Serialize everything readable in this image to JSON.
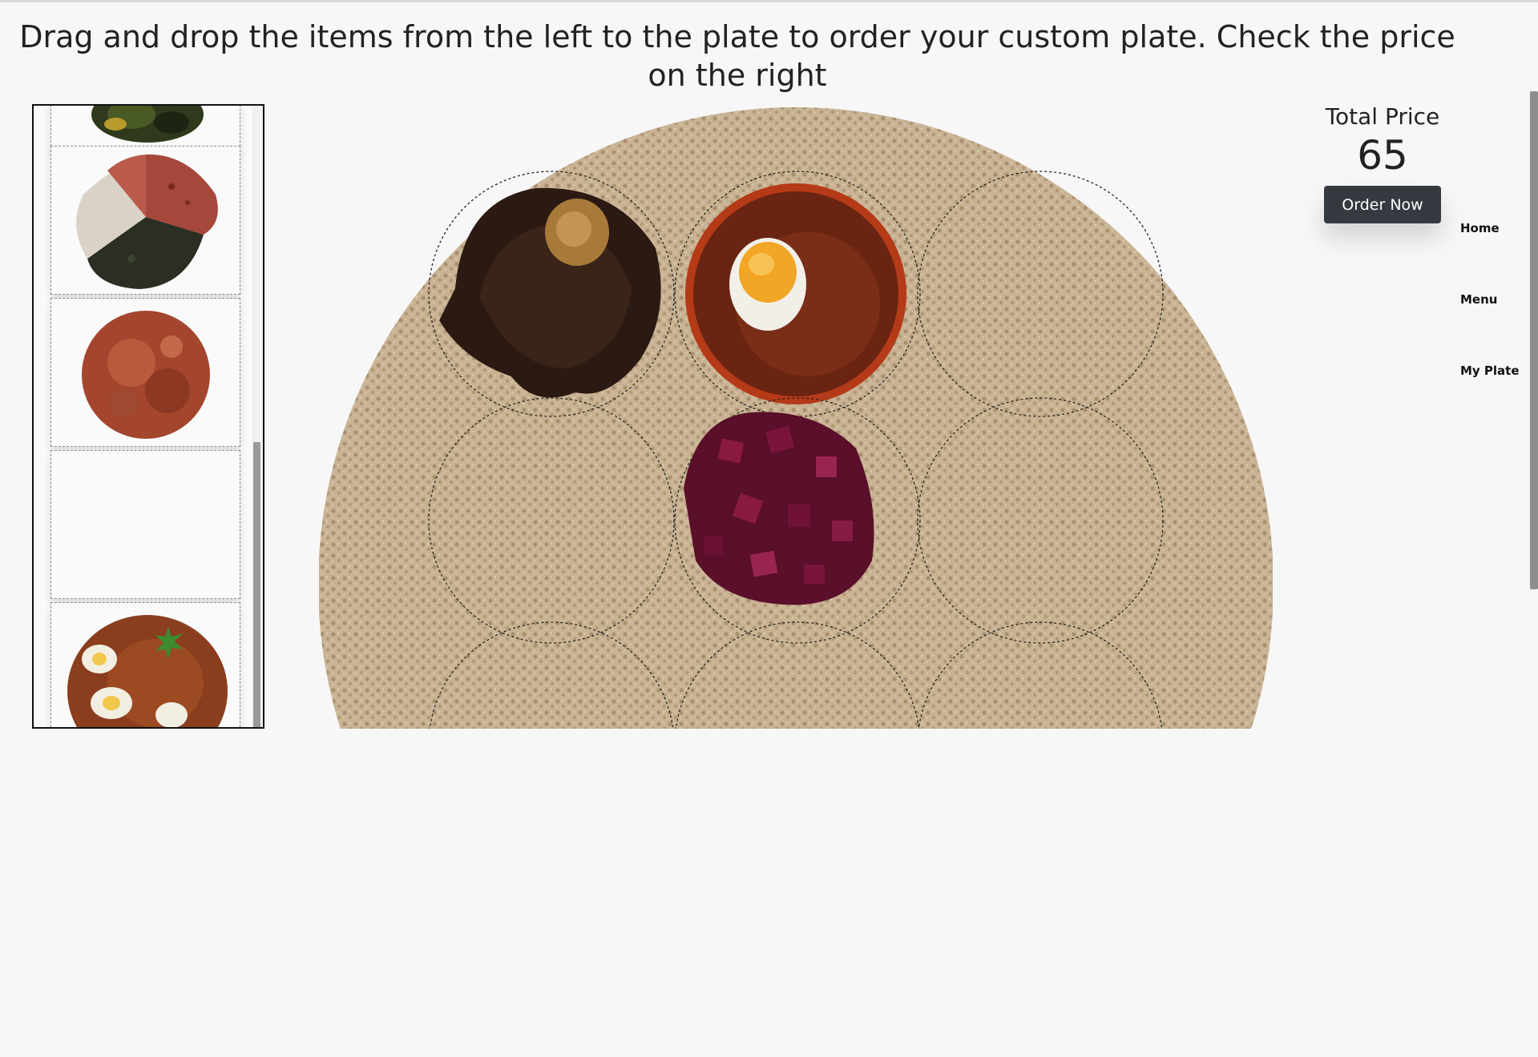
{
  "instructions": {
    "line1": "Drag and drop the items from the left to the plate to order your custom plate. Check the price",
    "line2": "on the right"
  },
  "price": {
    "label": "Total Price",
    "value": "65",
    "order_button": "Order Now"
  },
  "nav": {
    "items": [
      {
        "label": "Home"
      },
      {
        "label": "Menu"
      },
      {
        "label": "My Plate"
      }
    ]
  },
  "items_panel": {
    "cards": [
      {
        "icon": "greens-dish-icon"
      },
      {
        "icon": "mixed-combo-dish-icon"
      },
      {
        "icon": "minced-meat-dish-icon"
      },
      {
        "icon": "empty-slot"
      },
      {
        "icon": "chicken-egg-stew-icon"
      }
    ],
    "scroll_level": 0.75
  },
  "plate": {
    "slots": [
      {
        "filled": true,
        "dish": "dark-stew-with-egg-icon"
      },
      {
        "filled": true,
        "dish": "red-stew-with-egg-icon"
      },
      {
        "filled": false
      },
      {
        "filled": false
      },
      {
        "filled": true,
        "dish": "beetroot-salad-icon"
      },
      {
        "filled": false
      },
      {
        "filled": false
      },
      {
        "filled": false
      },
      {
        "filled": false
      }
    ]
  },
  "colors": {
    "injera": "#c9b394",
    "button": "#343a40"
  }
}
